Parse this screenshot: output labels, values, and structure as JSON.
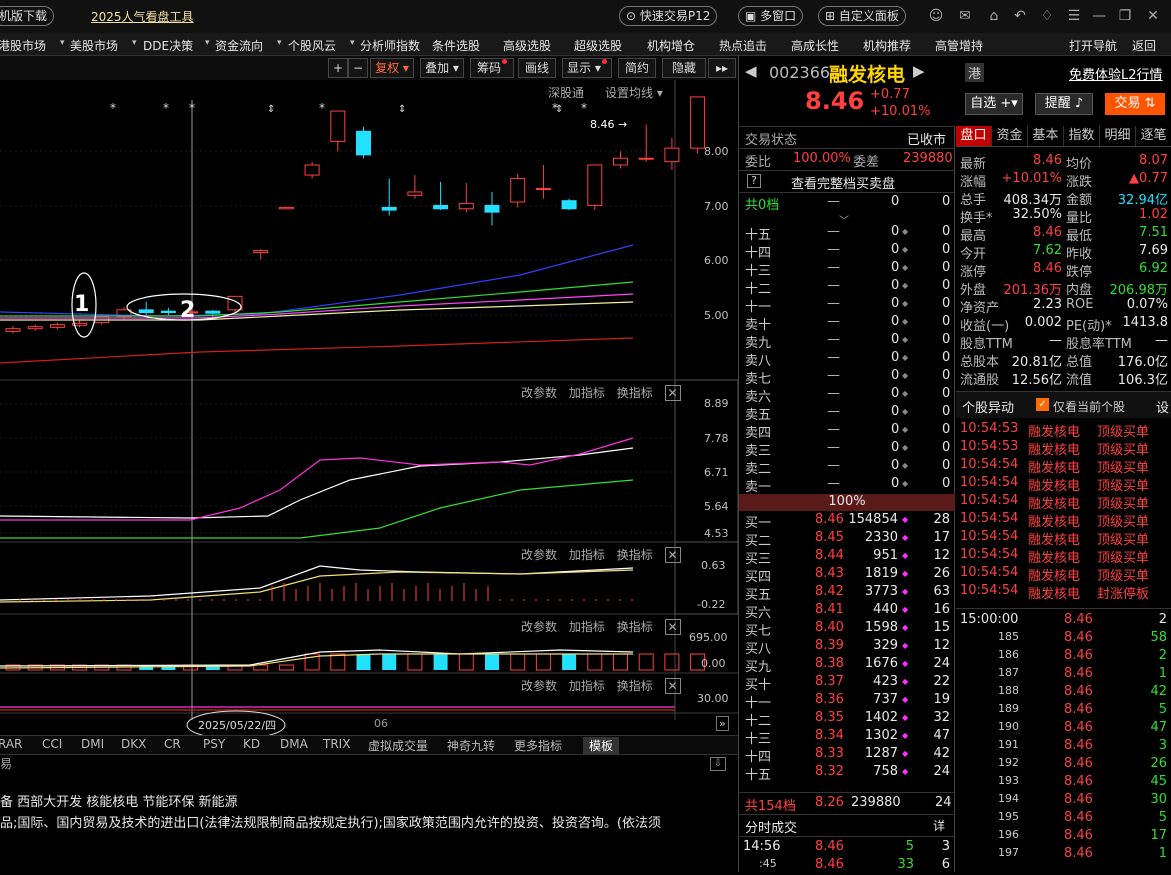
{
  "topbar": {
    "mobile_download": "机版下载",
    "popularity_tool": "2025人气看盘工具",
    "fast_trade": "快速交易P12",
    "multi_window": "多窗口",
    "custom_panel": "自定义面板"
  },
  "menu": [
    "港股市场",
    "美股市场",
    "DDE决策",
    "资金流向",
    "个股风云",
    "分析师指数",
    "条件选股",
    "高级选股",
    "超级选股",
    "机构增仓",
    "热点追击",
    "高成长性",
    "机构推荐",
    "高管增持",
    "打开导航",
    "返回"
  ],
  "toolbar": {
    "plus": "+",
    "minus": "−",
    "fuquan": "复权",
    "overlay": "叠加",
    "chips": "筹码",
    "draw": "画线",
    "display": "显示",
    "simple": "简约",
    "hide": "隐藏"
  },
  "chart": {
    "deep_link": "深股通",
    "set_ma": "设置均线",
    "last_price_label": "8.46",
    "main_axis": [
      "8.00",
      "7.00",
      "6.00",
      "5.00"
    ],
    "ind1_axis": [
      "8.89",
      "7.78",
      "6.71",
      "5.64",
      "4.53"
    ],
    "ind2_axis": [
      "0.63",
      "-0.22"
    ],
    "ind3_axis": [
      "695.00",
      "0.00"
    ],
    "ind4_axis": [
      "30.00"
    ],
    "panel_controls": [
      "改参数",
      "加指标",
      "换指标"
    ],
    "annotation_1": "1",
    "annotation_2": "2",
    "date_label": "2025/05/22/四",
    "month_label": "06"
  },
  "chart_data": {
    "type": "candlestick",
    "ylim": [
      4.6,
      8.6
    ],
    "candles": [
      {
        "o": 4.98,
        "c": 5.02,
        "h": 5.06,
        "l": 4.95
      },
      {
        "o": 5.02,
        "c": 5.05,
        "h": 5.08,
        "l": 4.99
      },
      {
        "o": 5.04,
        "c": 5.08,
        "h": 5.11,
        "l": 5.01
      },
      {
        "o": 5.07,
        "c": 5.1,
        "h": 5.14,
        "l": 5.04
      },
      {
        "o": 5.11,
        "c": 5.2,
        "h": 5.24,
        "l": 5.08
      },
      {
        "o": 5.2,
        "c": 5.3,
        "h": 5.34,
        "l": 5.16
      },
      {
        "o": 5.3,
        "c": 5.26,
        "h": 5.42,
        "l": 5.22
      },
      {
        "o": 5.28,
        "c": 5.26,
        "h": 5.33,
        "l": 5.22
      },
      {
        "o": 5.26,
        "c": 5.27,
        "h": 5.33,
        "l": 5.22
      },
      {
        "o": 5.28,
        "c": 5.25,
        "h": 5.3,
        "l": 5.2
      },
      {
        "o": 5.3,
        "c": 5.5,
        "h": 5.5,
        "l": 5.25
      },
      {
        "o": 6.15,
        "c": 6.18,
        "h": 6.2,
        "l": 6.05
      },
      {
        "o": 6.8,
        "c": 6.82,
        "h": 6.82,
        "l": 6.8
      },
      {
        "o": 7.3,
        "c": 7.45,
        "h": 7.5,
        "l": 7.25
      },
      {
        "o": 7.8,
        "c": 8.25,
        "h": 8.25,
        "l": 7.65
      },
      {
        "o": 7.95,
        "c": 7.6,
        "h": 8.02,
        "l": 7.55
      },
      {
        "o": 6.82,
        "c": 6.78,
        "h": 7.25,
        "l": 6.7
      },
      {
        "o": 7.0,
        "c": 7.05,
        "h": 7.3,
        "l": 6.95
      },
      {
        "o": 6.85,
        "c": 6.8,
        "h": 7.2,
        "l": 6.78
      },
      {
        "o": 6.8,
        "c": 6.88,
        "h": 7.18,
        "l": 6.75
      },
      {
        "o": 6.85,
        "c": 6.75,
        "h": 7.05,
        "l": 6.55
      },
      {
        "o": 6.9,
        "c": 7.25,
        "h": 7.32,
        "l": 6.82
      },
      {
        "o": 7.1,
        "c": 7.1,
        "h": 7.45,
        "l": 6.95
      },
      {
        "o": 6.92,
        "c": 6.8,
        "h": 6.95,
        "l": 6.78
      },
      {
        "o": 6.85,
        "c": 7.45,
        "h": 7.45,
        "l": 6.78
      },
      {
        "o": 7.45,
        "c": 7.55,
        "h": 7.65,
        "l": 7.4
      },
      {
        "o": 7.55,
        "c": 7.55,
        "h": 8.05,
        "l": 7.5
      },
      {
        "o": 7.5,
        "c": 7.7,
        "h": 7.85,
        "l": 7.38
      },
      {
        "o": 7.7,
        "c": 8.46,
        "h": 8.46,
        "l": 7.62
      }
    ]
  },
  "tabs": [
    "RAR",
    "CCI",
    "DMI",
    "DKX",
    "CR",
    "PSY",
    "KD",
    "DMA",
    "TRIX",
    "虚拟成交量",
    "神奇九转",
    "更多指标",
    "模板"
  ],
  "info": {
    "line1": "备  西部大开发  核能核电  节能环保  新能源",
    "line2": "品;国际、国内贸易及技术的进出口(法律法规限制商品按规定执行);国家政策范围内允许的投资、投资咨询。(依法须"
  },
  "quote": {
    "code": "002366",
    "name": "融发核电",
    "hk": "港",
    "l2_link": "免费体验L2行情",
    "price": "8.46",
    "change": "+0.77",
    "change_pct": "+10.01%",
    "watchlist": "自选",
    "alert": "提醒",
    "trade": "交易",
    "trade_status_label": "交易状态",
    "trade_status": "已收市",
    "weibi_label": "委比",
    "weibi": "100.00%",
    "weicha_label": "委差",
    "weicha": "239880",
    "full_book": "查看完整档买卖盘",
    "question": "?",
    "total_sell_label": "共0档",
    "total_sell_dash": "—",
    "total_sell_v": "0",
    "total_sell_n": "0",
    "mid_pct": "100%",
    "total_buy_label": "共154档",
    "total_buy_price": "8.26",
    "total_buy_v": "239880",
    "total_buy_n": "24",
    "fenshi_label": "分时成交",
    "fenshi_detail": "详"
  },
  "asks": [
    {
      "l": "十五"
    },
    {
      "l": "十四"
    },
    {
      "l": "十三"
    },
    {
      "l": "十二"
    },
    {
      "l": "十一"
    },
    {
      "l": "卖十"
    },
    {
      "l": "卖九"
    },
    {
      "l": "卖八"
    },
    {
      "l": "卖七"
    },
    {
      "l": "卖六"
    },
    {
      "l": "卖五"
    },
    {
      "l": "卖四"
    },
    {
      "l": "卖三"
    },
    {
      "l": "卖二"
    },
    {
      "l": "卖一"
    }
  ],
  "bids": [
    {
      "l": "买一",
      "p": "8.46",
      "v": "154854",
      "n": "28"
    },
    {
      "l": "买二",
      "p": "8.45",
      "v": "2330",
      "n": "17"
    },
    {
      "l": "买三",
      "p": "8.44",
      "v": "951",
      "n": "12"
    },
    {
      "l": "买四",
      "p": "8.43",
      "v": "1819",
      "n": "26"
    },
    {
      "l": "买五",
      "p": "8.42",
      "v": "3773",
      "n": "63"
    },
    {
      "l": "买六",
      "p": "8.41",
      "v": "440",
      "n": "16"
    },
    {
      "l": "买七",
      "p": "8.40",
      "v": "1598",
      "n": "15"
    },
    {
      "l": "买八",
      "p": "8.39",
      "v": "329",
      "n": "12"
    },
    {
      "l": "买九",
      "p": "8.38",
      "v": "1676",
      "n": "24"
    },
    {
      "l": "买十",
      "p": "8.37",
      "v": "423",
      "n": "22"
    },
    {
      "l": "十一",
      "p": "8.36",
      "v": "737",
      "n": "19"
    },
    {
      "l": "十二",
      "p": "8.35",
      "v": "1402",
      "n": "32"
    },
    {
      "l": "十三",
      "p": "8.34",
      "v": "1302",
      "n": "47"
    },
    {
      "l": "十四",
      "p": "8.33",
      "v": "1287",
      "n": "42"
    },
    {
      "l": "十五",
      "p": "8.32",
      "v": "758",
      "n": "24"
    }
  ],
  "qtabs": [
    "盘口",
    "资金",
    "基本",
    "指数",
    "明细",
    "逐笔"
  ],
  "stats": [
    [
      "最新",
      "8.46",
      "red",
      "均价",
      "8.07",
      "red"
    ],
    [
      "涨幅",
      "+10.01%",
      "red",
      "涨跌",
      "▲0.77",
      "red"
    ],
    [
      "总手",
      "408.34万",
      "white",
      "金额",
      "32.94亿",
      "cyan"
    ],
    [
      "换手*",
      "32.50%",
      "white",
      "量比",
      "1.02",
      "red"
    ],
    [
      "最高",
      "8.46",
      "red",
      "最低",
      "7.51",
      "green"
    ],
    [
      "今开",
      "7.62",
      "green",
      "昨收",
      "7.69",
      "white"
    ],
    [
      "涨停",
      "8.46",
      "red",
      "跌停",
      "6.92",
      "green"
    ],
    [
      "外盘",
      "201.36万",
      "red",
      "内盘",
      "206.98万",
      "green"
    ],
    [
      "净资产",
      "2.23",
      "white",
      "ROE",
      "0.07%",
      "white"
    ],
    [
      "收益(一)",
      "0.002",
      "white",
      "PE(动)*",
      "1413.8",
      "white"
    ],
    [
      "股息TTM",
      "—",
      "white",
      "股息率TTM",
      "—",
      "white"
    ],
    [
      "总股本",
      "20.81亿",
      "white",
      "总值",
      "176.0亿",
      "white"
    ],
    [
      "流通股",
      "12.56亿",
      "white",
      "流值",
      "106.3亿",
      "white"
    ]
  ],
  "anomaly": {
    "title": "个股异动",
    "only_current": "仅看当前个股",
    "settings": "设",
    "rows": [
      [
        "10:54:53",
        "融发核电",
        "顶级买单"
      ],
      [
        "10:54:53",
        "融发核电",
        "顶级买单"
      ],
      [
        "10:54:54",
        "融发核电",
        "顶级买单"
      ],
      [
        "10:54:54",
        "融发核电",
        "顶级买单"
      ],
      [
        "10:54:54",
        "融发核电",
        "顶级买单"
      ],
      [
        "10:54:54",
        "融发核电",
        "顶级买单"
      ],
      [
        "10:54:54",
        "融发核电",
        "顶级买单"
      ],
      [
        "10:54:54",
        "融发核电",
        "顶级买单"
      ],
      [
        "10:54:54",
        "融发核电",
        "顶级买单"
      ],
      [
        "10:54:54",
        "融发核电",
        "封涨停板"
      ]
    ]
  },
  "ticks": [
    [
      "15:00:00",
      "8.46",
      "2"
    ],
    [
      "185",
      "8.46",
      "58"
    ],
    [
      "186",
      "8.46",
      "2"
    ],
    [
      "187",
      "8.46",
      "1"
    ],
    [
      "188",
      "8.46",
      "42"
    ],
    [
      "189",
      "8.46",
      "5"
    ],
    [
      "190",
      "8.46",
      "47"
    ],
    [
      "191",
      "8.46",
      "3"
    ],
    [
      "192",
      "8.46",
      "26"
    ],
    [
      "193",
      "8.46",
      "45"
    ],
    [
      "194",
      "8.46",
      "30"
    ],
    [
      "195",
      "8.46",
      "5"
    ],
    [
      "196",
      "8.46",
      "17"
    ],
    [
      "197",
      "8.46",
      "1"
    ]
  ],
  "fenshi_rows": [
    [
      "14:56",
      "8.46",
      "5",
      "3"
    ],
    [
      ":45",
      "8.46",
      "33",
      "6"
    ]
  ]
}
